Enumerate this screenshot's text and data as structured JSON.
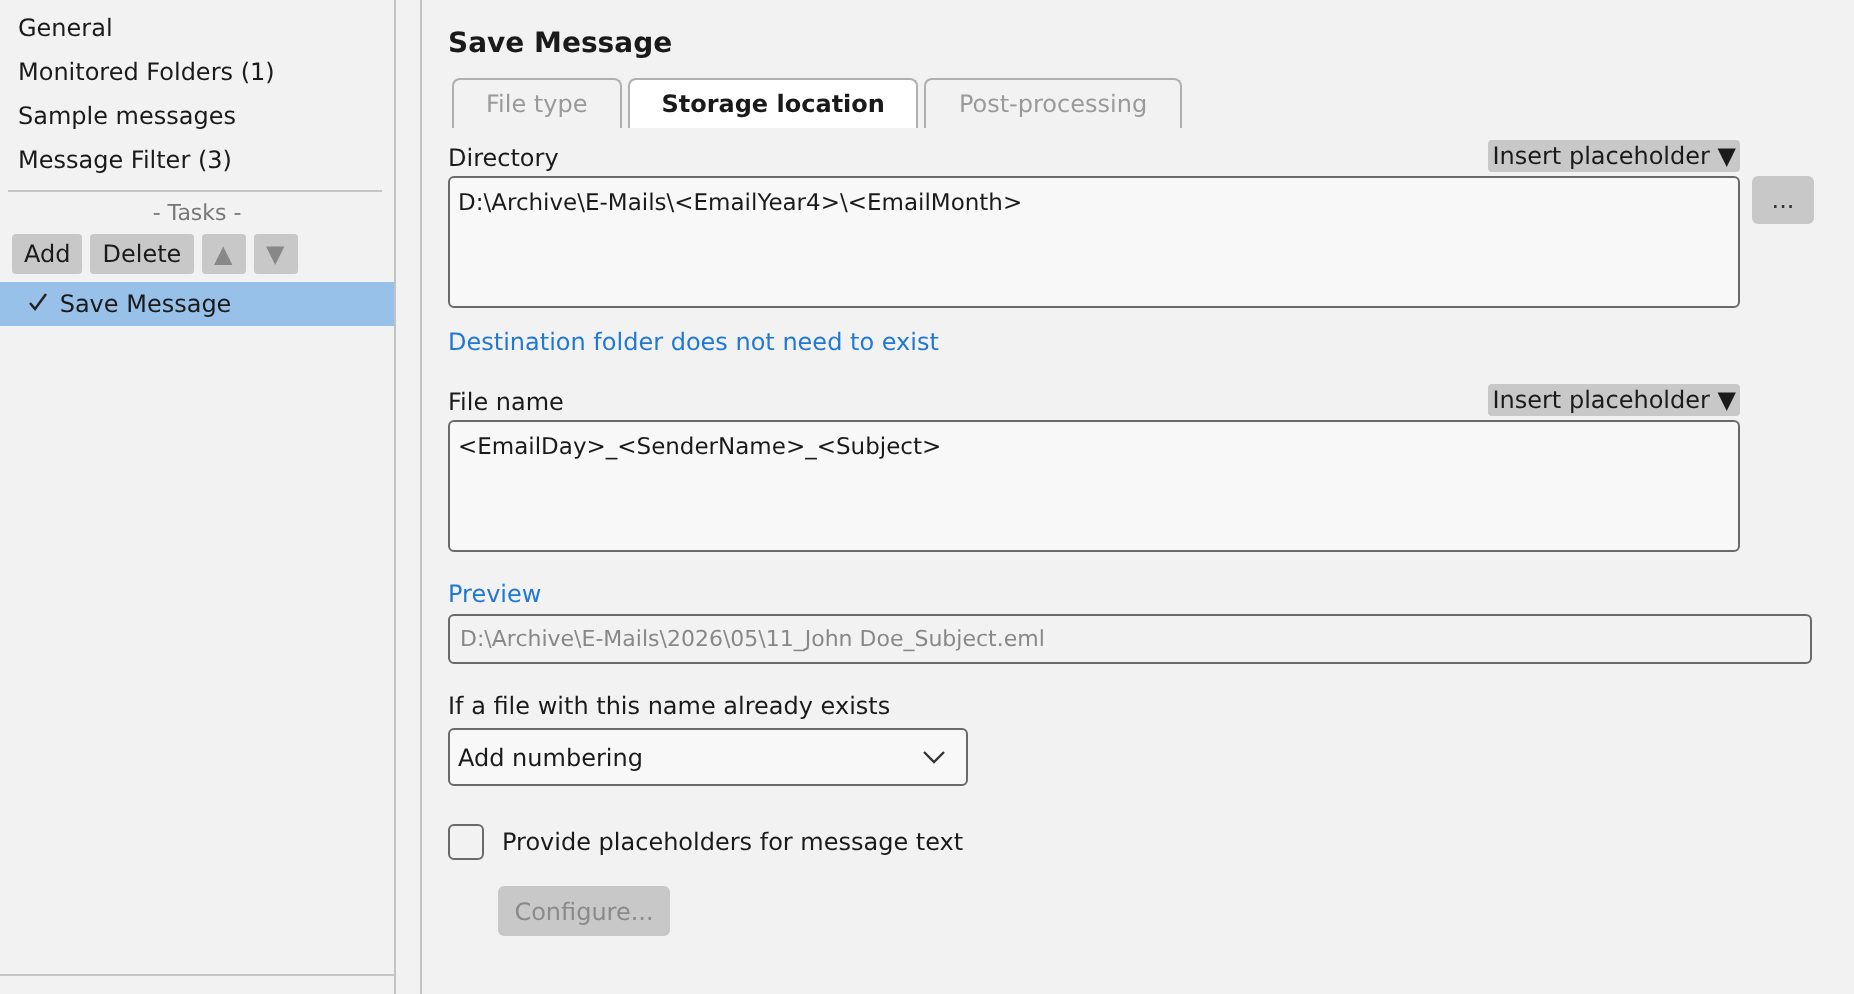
{
  "sidebar": {
    "items": [
      {
        "label": "General",
        "selected": false
      },
      {
        "label": "Monitored Folders (1)",
        "selected": false
      },
      {
        "label": "Sample messages",
        "selected": false
      },
      {
        "label": "Message Filter (3)",
        "selected": false
      }
    ],
    "tasks_heading": "- Tasks -",
    "task_buttons": [
      {
        "label": "Add",
        "kind": "text"
      },
      {
        "label": "Delete",
        "kind": "text"
      },
      {
        "label": "▲",
        "kind": "arrow"
      },
      {
        "label": "▼",
        "kind": "arrow"
      }
    ],
    "tasks": [
      {
        "label": "Save Message",
        "checked": true,
        "selected": true
      }
    ]
  },
  "panel": {
    "title": "Save Message",
    "tabs": [
      {
        "label": "File type",
        "selected": false,
        "disabled": true
      },
      {
        "label": "Storage location",
        "selected": true,
        "disabled": false
      },
      {
        "label": "Post-processing",
        "selected": false,
        "disabled": true
      }
    ],
    "directory": {
      "label": "Directory",
      "insert_button": "Insert placeholder ▼",
      "value": "D:\\Archive\\E-Mails\\<EmailYear4>\\<EmailMonth>",
      "browse_button": "...",
      "hint": "Destination folder does not need to exist"
    },
    "file_name": {
      "label": "File name",
      "insert_button": "Insert placeholder ▼",
      "value": "<EmailDay>_<SenderName>_<Subject>"
    },
    "preview": {
      "label": "Preview",
      "value": "D:\\Archive\\E-Mails\\2026\\05\\11_John Doe_Subject.eml"
    },
    "exists": {
      "label": "If a file with this name already exists",
      "value": "Add numbering"
    },
    "placeholders_checkbox": {
      "label": "Provide placeholders for message text",
      "checked": false
    },
    "configure_button": {
      "label": "Configure...",
      "disabled": true
    }
  }
}
